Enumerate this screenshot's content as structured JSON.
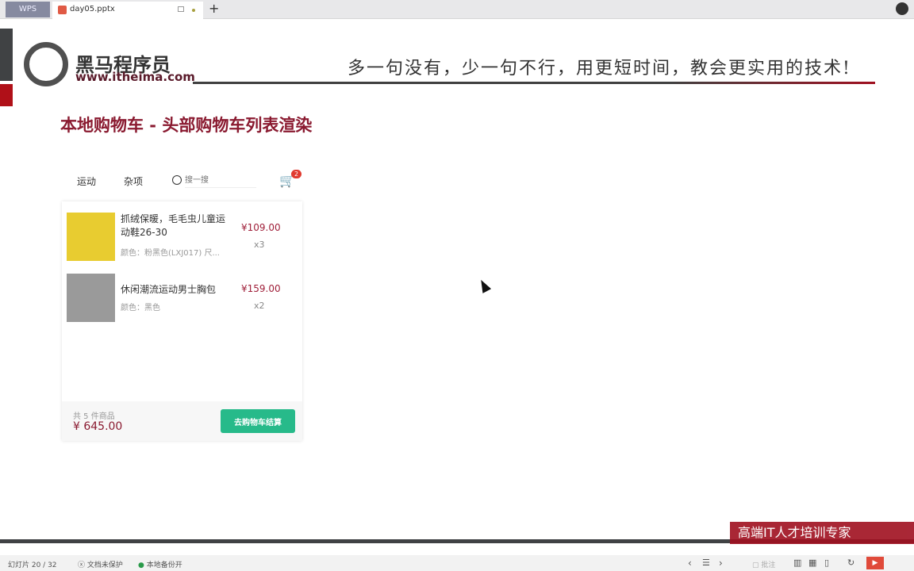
{
  "tabs": {
    "wps": "WPS",
    "doc": "day05.pptx",
    "new_tab": "+"
  },
  "slide": {
    "logo_cn": "黑马程序员",
    "logo_url": "www.itheima.com",
    "slogan": "多一句没有，少一句不行，用更短时间，教会更实用的技术!",
    "title": "本地购物车 - 头部购物车列表渲染",
    "brand_band": "高端IT人才培训专家"
  },
  "demo": {
    "nav": [
      "运动",
      "杂项"
    ],
    "search_placeholder": "搜一搜",
    "cart_badge": "2",
    "items": [
      {
        "name": "抓绒保暖，毛毛虫儿童运动鞋26-30",
        "attr": "颜色：粉黑色(LXJ017) 尺...",
        "price": "¥109.00",
        "qty": "x3",
        "thumb_color": "#e8cc30"
      },
      {
        "name": "休闲潮流运动男士胸包",
        "attr": "颜色：黑色",
        "price": "¥159.00",
        "qty": "x2",
        "thumb_color": "#9a9a9a"
      }
    ],
    "count": "共 5 件商品",
    "total": "¥ 645.00",
    "checkout": "去购物车结算"
  },
  "status": {
    "slide": "幻灯片 20 / 32",
    "protect": "文档未保护",
    "backup": "本地备份开",
    "note": "批注"
  }
}
